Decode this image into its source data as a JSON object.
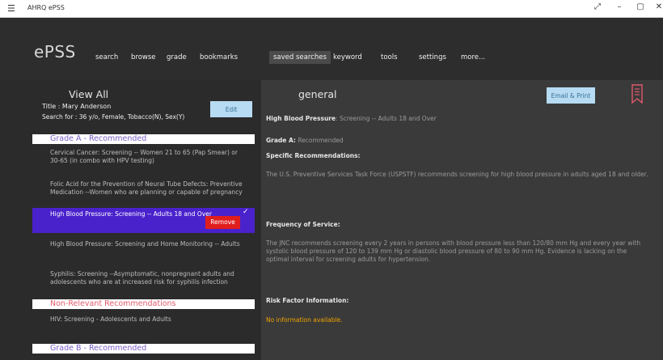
{
  "window": {
    "title": "AHRQ ePSS"
  },
  "nav": {
    "logo": "ePSS",
    "items": [
      {
        "label": "search"
      },
      {
        "label": "browse"
      },
      {
        "label": "grade"
      },
      {
        "label": "bookmarks"
      },
      {
        "label": "saved searches",
        "active": true
      },
      {
        "label": "keyword"
      },
      {
        "label": "tools"
      },
      {
        "label": "settings"
      },
      {
        "label": "more..."
      }
    ]
  },
  "left": {
    "heading": "View All",
    "title_line": "Title : Mary Anderson",
    "search_line": "Search for : 36 y/o, Female, Tobacco(N), Sex(Y)",
    "edit_label": "Edit",
    "grade_a": "Grade A - Recommended",
    "items_a": [
      "Cervical Cancer: Screening -- Women 21 to 65 (Pap Smear) or 30-65 (in combo with HPV testing)",
      "Folic Acid for the Prevention of Neural Tube Defects: Preventive Medication --Women who are planning or capable of pregnancy",
      "High Blood Pressure: Screening -- Adults 18 and Over",
      "High Blood Pressure: Screening and Home Monitoring -- Adults",
      "Syphilis: Screening --Asymptomatic, nonpregnant adults and adolescents who are at increased risk for syphilis infection"
    ],
    "remove_label": "Remove",
    "nonrel": "Non-Relevant Recommendations",
    "items_nonrel": [
      "HIV: Screening - Adolescents and Adults"
    ],
    "grade_b": "Grade B - Recommended"
  },
  "right": {
    "heading": "general",
    "email_label": "Email & Print",
    "rec_title_label": "High Blood Pressure",
    "rec_title_value": ": Screening -- Adults 18 and Over",
    "grade_label": "Grade A:",
    "grade_value": " Recommended",
    "specific_label": "Specific Recommendations:",
    "specific_text": "The U.S. Preventive Services Task Force (USPSTF) recommends screening for high blood pressure in adults aged 18 and older.",
    "freq_label": "Frequency of Service:",
    "freq_text": "The JNC recommends screening every 2 years in persons with blood pressure less than 120/80 mm Hg and every year with systolic blood pressure of 120 to 139 mm Hg or diastolic blood pressure of 80 to 90 mm Hg. Evidence is lacking on the optimal interval for screening adults for hypertension.",
    "risk_label": "Risk Factor Information:",
    "risk_text": "No information available."
  },
  "colors": {
    "accent_purple": "#4a22cc",
    "remove_red": "#e01e1e",
    "button_blue": "#b6dbf3",
    "warning_orange": "#f0a400"
  }
}
